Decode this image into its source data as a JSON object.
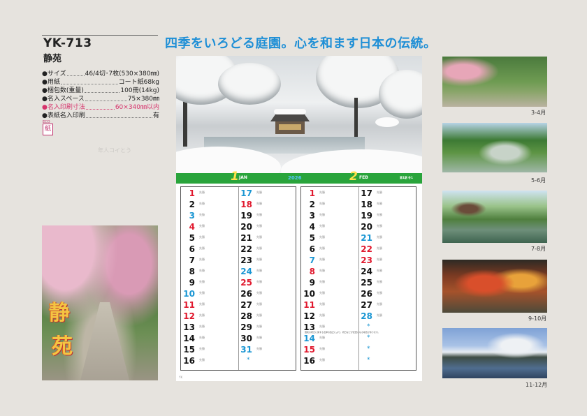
{
  "product": {
    "model": "YK-713",
    "name": "静苑"
  },
  "specs": [
    {
      "label": "●サイズ",
      "value": "46/4切･7枚(530×380㎜)",
      "highlight": false
    },
    {
      "label": "●用紙",
      "value": "コート紙68kg",
      "highlight": false
    },
    {
      "label": "●梱包数(重量)",
      "value": "100冊(14kg)",
      "highlight": false
    },
    {
      "label": "●名入スペース",
      "value": "75×380㎜",
      "highlight": false
    },
    {
      "label": "●名入印刷寸法",
      "value": "60×340㎜以内",
      "highlight": true
    },
    {
      "label": "●表紙名入印刷",
      "value": "有",
      "highlight": false
    }
  ],
  "paper_badge": "紙",
  "paper_badge_top": "ECO",
  "cover_logo": [
    "静",
    "苑"
  ],
  "headline": "四季をいろどる庭園。心を和ます日本の伝統。",
  "month_bar": {
    "month1_num": "1",
    "month1_eng": "JAN",
    "year": "2026",
    "month2_num": "2",
    "month2_eng": "FEB",
    "code": "第1期 冬1"
  },
  "calendar_jan": {
    "col1": [
      {
        "d": "1",
        "c": "red"
      },
      {
        "d": "2",
        "c": "black"
      },
      {
        "d": "3",
        "c": "blue"
      },
      {
        "d": "4",
        "c": "red"
      },
      {
        "d": "5",
        "c": "black"
      },
      {
        "d": "6",
        "c": "black"
      },
      {
        "d": "7",
        "c": "black"
      },
      {
        "d": "8",
        "c": "black"
      },
      {
        "d": "9",
        "c": "black"
      },
      {
        "d": "10",
        "c": "blue"
      },
      {
        "d": "11",
        "c": "red"
      },
      {
        "d": "12",
        "c": "red"
      },
      {
        "d": "13",
        "c": "black"
      },
      {
        "d": "14",
        "c": "black"
      },
      {
        "d": "15",
        "c": "black"
      },
      {
        "d": "16",
        "c": "black"
      }
    ],
    "col2": [
      {
        "d": "17",
        "c": "blue"
      },
      {
        "d": "18",
        "c": "red"
      },
      {
        "d": "19",
        "c": "black"
      },
      {
        "d": "20",
        "c": "black"
      },
      {
        "d": "21",
        "c": "black"
      },
      {
        "d": "22",
        "c": "black"
      },
      {
        "d": "23",
        "c": "black"
      },
      {
        "d": "24",
        "c": "blue"
      },
      {
        "d": "25",
        "c": "red"
      },
      {
        "d": "26",
        "c": "black"
      },
      {
        "d": "27",
        "c": "black"
      },
      {
        "d": "28",
        "c": "black"
      },
      {
        "d": "29",
        "c": "black"
      },
      {
        "d": "30",
        "c": "black"
      },
      {
        "d": "31",
        "c": "blue"
      },
      {
        "d": "",
        "c": "black"
      }
    ]
  },
  "calendar_feb": {
    "col1": [
      {
        "d": "1",
        "c": "red"
      },
      {
        "d": "2",
        "c": "black"
      },
      {
        "d": "3",
        "c": "black"
      },
      {
        "d": "4",
        "c": "black"
      },
      {
        "d": "5",
        "c": "black"
      },
      {
        "d": "6",
        "c": "black"
      },
      {
        "d": "7",
        "c": "blue"
      },
      {
        "d": "8",
        "c": "red"
      },
      {
        "d": "9",
        "c": "black"
      },
      {
        "d": "10",
        "c": "black"
      },
      {
        "d": "11",
        "c": "red"
      },
      {
        "d": "12",
        "c": "black"
      },
      {
        "d": "13",
        "c": "black"
      },
      {
        "d": "14",
        "c": "blue"
      },
      {
        "d": "15",
        "c": "red"
      },
      {
        "d": "16",
        "c": "black"
      }
    ],
    "col2": [
      {
        "d": "17",
        "c": "black"
      },
      {
        "d": "18",
        "c": "black"
      },
      {
        "d": "19",
        "c": "black"
      },
      {
        "d": "20",
        "c": "black"
      },
      {
        "d": "21",
        "c": "blue"
      },
      {
        "d": "22",
        "c": "red"
      },
      {
        "d": "23",
        "c": "red"
      },
      {
        "d": "24",
        "c": "black"
      },
      {
        "d": "25",
        "c": "black"
      },
      {
        "d": "26",
        "c": "black"
      },
      {
        "d": "27",
        "c": "black"
      },
      {
        "d": "28",
        "c": "blue"
      },
      {
        "d": "",
        "c": "black"
      },
      {
        "d": "",
        "c": "black"
      },
      {
        "d": "",
        "c": "black"
      },
      {
        "d": "",
        "c": "black"
      }
    ]
  },
  "rokuyo": "先勝",
  "footnote": "国民の祝日に関する法律の改正により、祝日などが変更になる場合があります。",
  "sheet_mark": "YK",
  "month_labels": [
    "3-4月",
    "5-6月",
    "7-8月",
    "9-10月",
    "11-12月"
  ],
  "watermark": "年人コイとう",
  "colors": {
    "headline": "#1f8fd6",
    "month_bar": "#29a43b",
    "sunday": "#e0182d",
    "saturday": "#1a96d3",
    "highlight_spec": "#d6336c"
  }
}
